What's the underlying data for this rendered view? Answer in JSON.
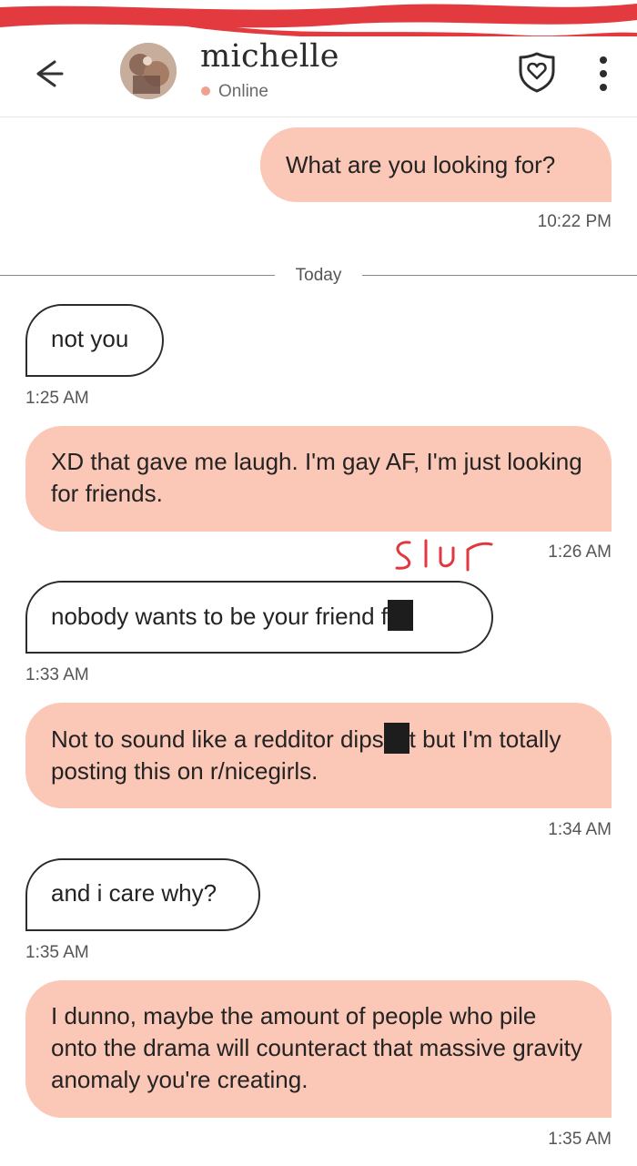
{
  "header": {
    "contact_name": "michelle",
    "status": "Online",
    "icons": {
      "back": "arrow-left-icon",
      "shield": "shield-heart-icon",
      "more": "more-vertical-icon"
    }
  },
  "colors": {
    "outgoing_bubble": "#fbc7b6",
    "status_dot": "#f0a08c",
    "annotation_red": "#e0383e"
  },
  "messages": [
    {
      "direction": "outgoing",
      "text": "What are you looking for?",
      "time": "10:22 PM"
    },
    {
      "divider": "Today"
    },
    {
      "direction": "incoming",
      "text": "not you",
      "time": "1:25 AM"
    },
    {
      "direction": "outgoing",
      "text": "XD that gave me laugh. I'm gay AF, I'm just looking for friends.",
      "time": "1:26 AM"
    },
    {
      "direction": "incoming",
      "text_before_redaction": "nobody wants to be your friend f",
      "time": "1:33 AM",
      "annotation": "slur"
    },
    {
      "direction": "outgoing",
      "text_before_redaction": "Not to sound like a redditor dips",
      "text_after_redaction": "t but I'm totally posting this on r/nicegirls.",
      "time": "1:34 AM"
    },
    {
      "direction": "incoming",
      "text": "and i care why?",
      "time": "1:35 AM"
    },
    {
      "direction": "outgoing",
      "text": "I dunno, maybe the amount of people who pile onto the drama will counteract that massive gravity anomaly you're creating.",
      "time": "1:35 AM"
    }
  ]
}
